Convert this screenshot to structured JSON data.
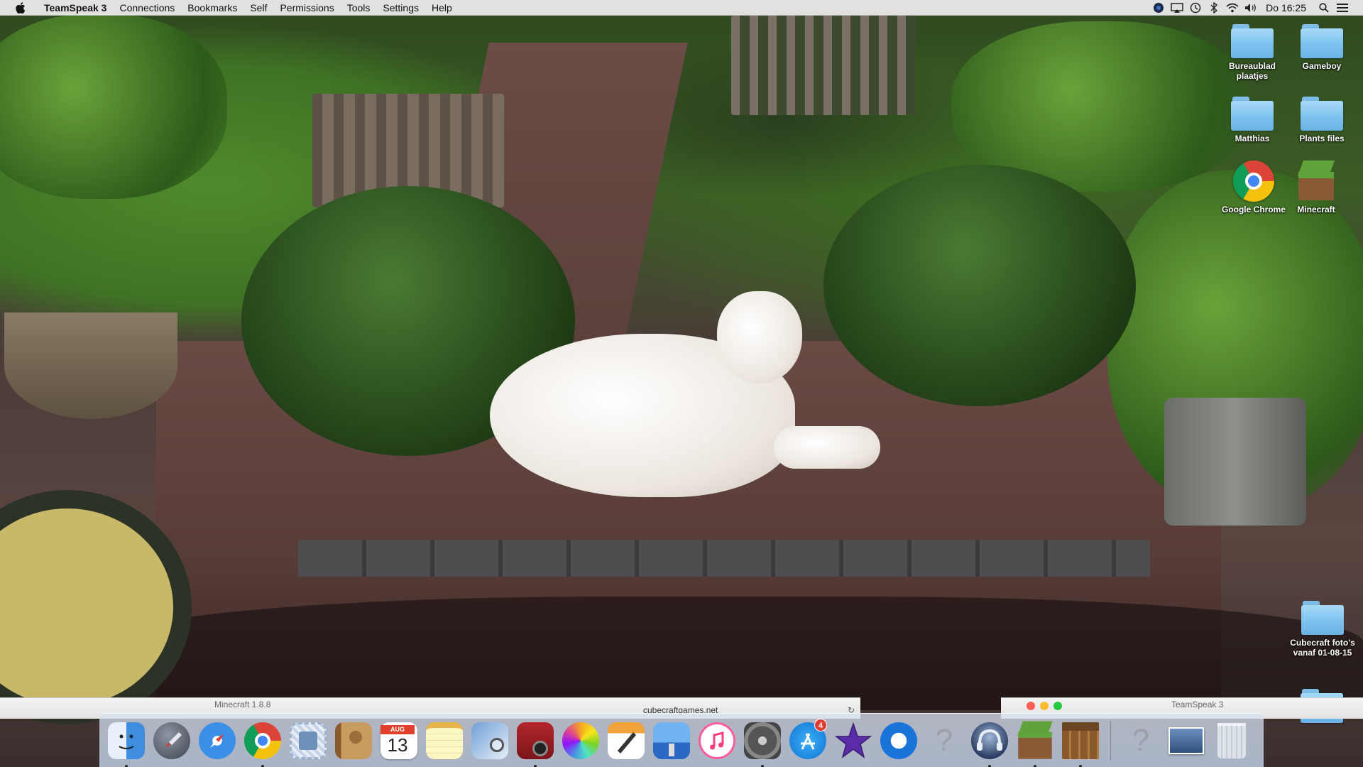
{
  "menubar": {
    "app_name": "TeamSpeak 3",
    "menus": [
      "Connections",
      "Bookmarks",
      "Self",
      "Permissions",
      "Tools",
      "Settings",
      "Help"
    ],
    "clock": "Do 16:25",
    "status_icons": [
      "teamspeak-status-icon",
      "airplay-icon",
      "time-machine-icon",
      "bluetooth-icon",
      "wifi-icon",
      "volume-icon"
    ]
  },
  "desktop": {
    "icons": [
      {
        "label": "Bureaublad plaatjes",
        "type": "folder"
      },
      {
        "label": "Gameboy",
        "type": "folder"
      },
      {
        "label": "Matthias",
        "type": "folder"
      },
      {
        "label": "Plants files",
        "type": "folder"
      },
      {
        "label": "Google Chrome",
        "type": "app"
      },
      {
        "label": "Minecraft",
        "type": "app"
      },
      {
        "label": "Cubecraft foto's vanaf 01-08-15",
        "type": "folder"
      }
    ]
  },
  "windows": {
    "minecraft_title": "Minecraft 1.8.8",
    "browser_url": "cubecraftgames.net",
    "teamspeak_title": "TeamSpeak 3"
  },
  "dock": {
    "calendar_month": "AUG",
    "calendar_day": "13",
    "app_store_badge": "4",
    "apps": [
      "Finder",
      "Launchpad",
      "Safari",
      "Google Chrome",
      "Mail",
      "Contacts",
      "Calendar",
      "Notes",
      "Preview",
      "Photo Booth",
      "Photos",
      "Pages",
      "Keynote",
      "iTunes",
      "System Preferences",
      "App Store",
      "iMovie",
      "QuickTime Player",
      "Unknown",
      "TeamSpeak 3",
      "Minecraft",
      "Minecraft Launcher",
      "Unknown",
      "Desktop Stack",
      "Trash"
    ]
  },
  "colors": {
    "menubar_bg": "#ececec",
    "folder_blue": "#7cc2ef",
    "dock_bg": "#c8d4e6"
  }
}
